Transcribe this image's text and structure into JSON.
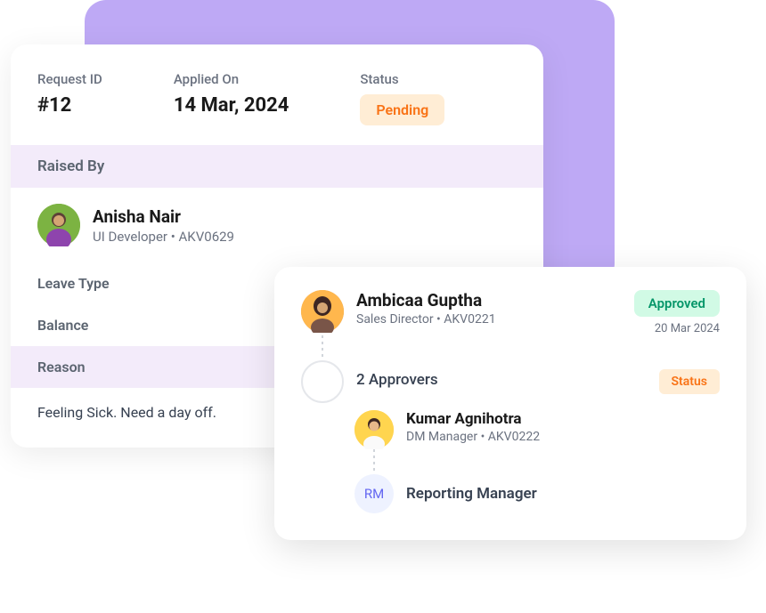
{
  "header": {
    "requestIdLabel": "Request ID",
    "requestId": "#12",
    "appliedOnLabel": "Applied On",
    "appliedOn": "14 Mar, 2024",
    "statusLabel": "Status",
    "status": "Pending"
  },
  "raisedBy": {
    "sectionLabel": "Raised By",
    "name": "Anisha Nair",
    "subtitle": "UI Developer  • AKV0629"
  },
  "details": {
    "leaveTypeLabel": "Leave Type",
    "balanceLabel": "Balance",
    "reasonLabel": "Reason",
    "reasonText": "Feeling Sick. Need a day off."
  },
  "approvers": {
    "first": {
      "name": "Ambicaa Guptha",
      "subtitle": "Sales Director • AKV0221",
      "status": "Approved",
      "date": "20 Mar 2024"
    },
    "countLabel": "2 Approvers",
    "statusBadge": "Status",
    "second": {
      "name": "Kumar Agnihotra",
      "subtitle": "DM Manager • AKV0222"
    },
    "rm": {
      "initials": "RM",
      "label": "Reporting Manager"
    }
  }
}
